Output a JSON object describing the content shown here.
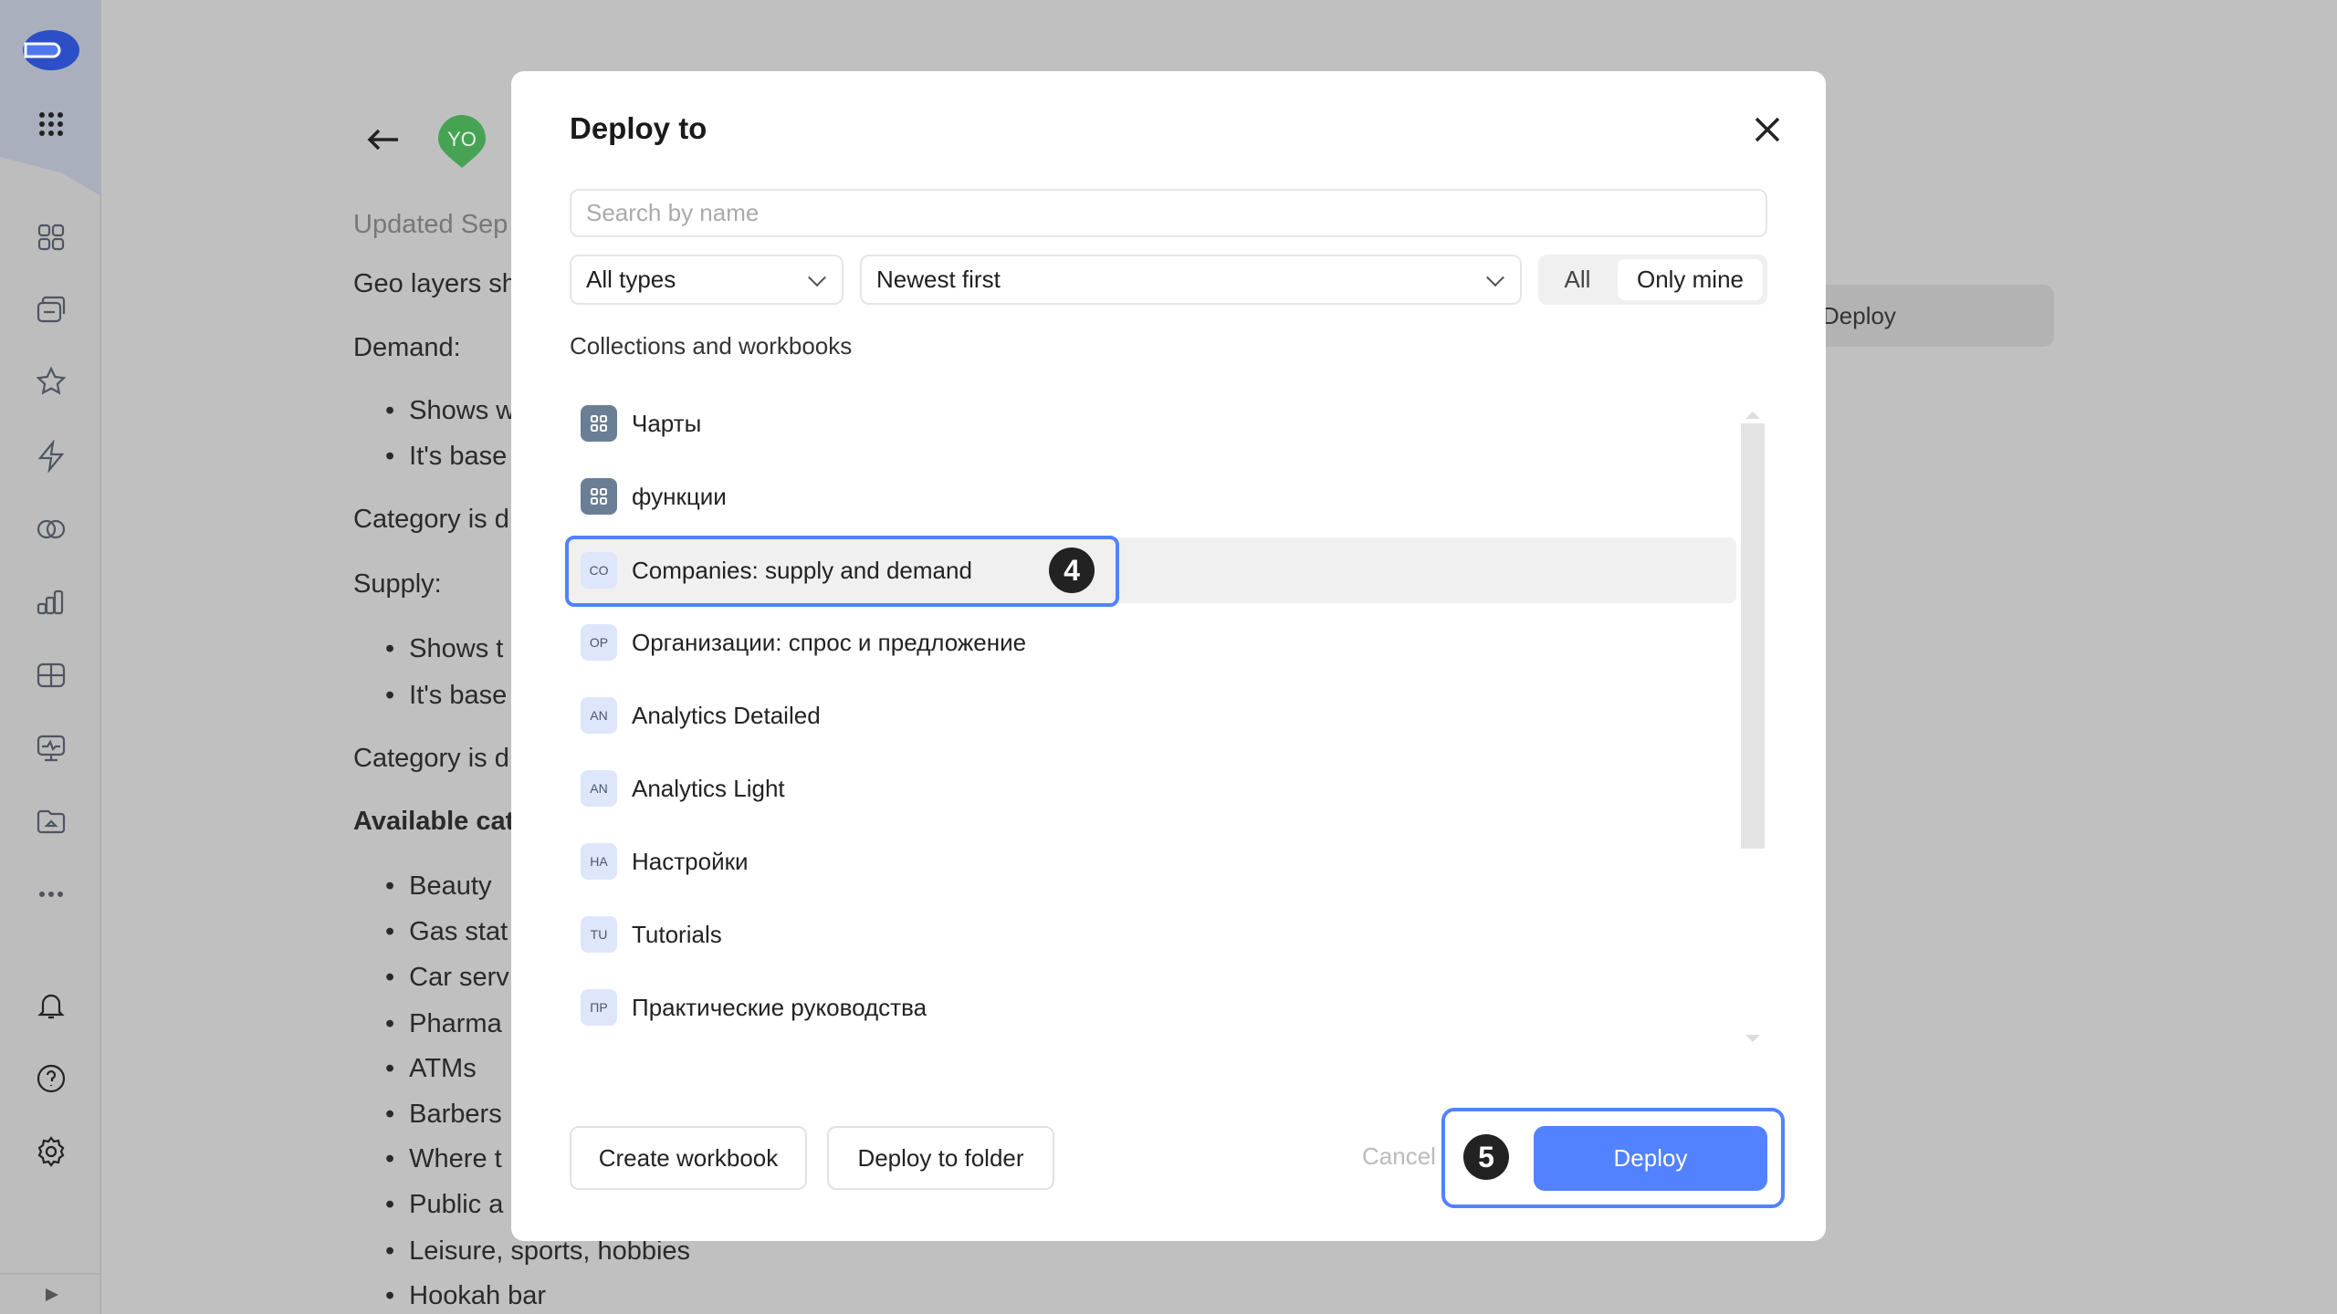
{
  "sidebar": {
    "icons": [
      "logo-icon",
      "apps-grid-icon",
      "collections-icon",
      "workbooks-icon",
      "favorites-icon",
      "connections-icon",
      "datasets-icon",
      "charts-icon",
      "dashboards-icon",
      "monitoring-icon",
      "folder-icon",
      "more-icon",
      "notifications-icon",
      "help-icon",
      "settings-icon",
      "expand-icon"
    ]
  },
  "background": {
    "avatar": "YO",
    "updated": "Updated Sep",
    "lines": [
      "Geo layers sh",
      "Demand:",
      "Category is d",
      "Supply:",
      "Category is d",
      "Available cat"
    ],
    "demand_bullets": [
      "Shows w",
      "It's base"
    ],
    "supply_bullets": [
      "Shows t",
      "It's base"
    ],
    "categories": [
      "Beauty",
      "Gas stat",
      "Car serv",
      "Pharma",
      "ATMs",
      "Barbers",
      "Where t",
      "Public a",
      "Leisure, sports, hobbies",
      "Hookah bar"
    ],
    "deploy_button": "Deploy"
  },
  "modal": {
    "title": "Deploy to",
    "search_placeholder": "Search by name",
    "type_filter": "All types",
    "sort": "Newest first",
    "segment": {
      "all": "All",
      "only_mine": "Only mine",
      "selected": "Only mine"
    },
    "section_label": "Collections and workbooks",
    "items": [
      {
        "icon": "ЧА",
        "kind": "collection",
        "label": "Чарты"
      },
      {
        "icon": "ФУ",
        "kind": "collection",
        "label": "функции"
      },
      {
        "icon": "CO",
        "kind": "workbook",
        "label": "Companies: supply and demand",
        "selected": true
      },
      {
        "icon": "OP",
        "kind": "workbook",
        "label": "Организации: спрос и предложение"
      },
      {
        "icon": "AN",
        "kind": "workbook",
        "label": "Analytics Detailed"
      },
      {
        "icon": "AN",
        "kind": "workbook",
        "label": "Analytics Light"
      },
      {
        "icon": "HA",
        "kind": "workbook",
        "label": "Настройки"
      },
      {
        "icon": "TU",
        "kind": "workbook",
        "label": "Tutorials"
      },
      {
        "icon": "ПР",
        "kind": "workbook",
        "label": "Практические руководства"
      }
    ],
    "create_workbook": "Create workbook",
    "deploy_to_folder": "Deploy to folder",
    "cancel": "Cancel",
    "deploy": "Deploy",
    "step_badges": [
      "4",
      "5"
    ],
    "accent": "#5282ff"
  }
}
